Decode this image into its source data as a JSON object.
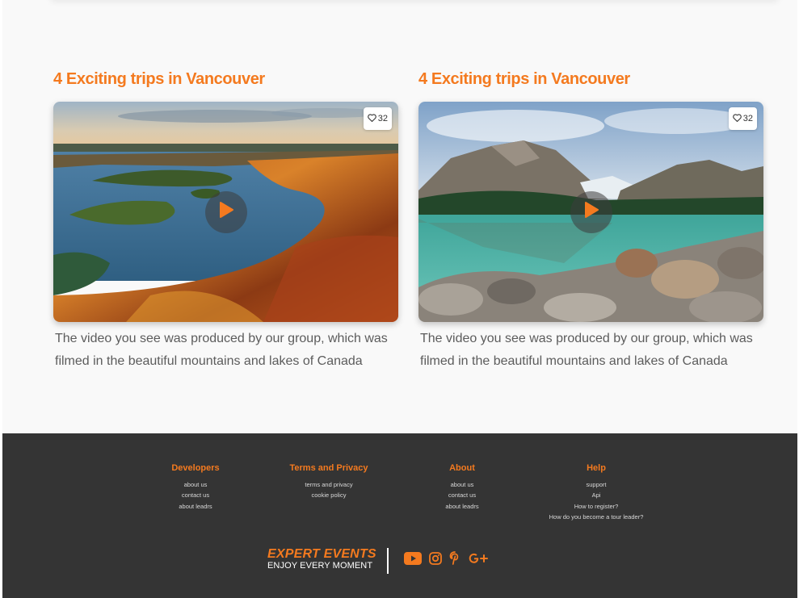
{
  "cards": [
    {
      "title": "4 Exciting trips in Vancouver",
      "likes": "32",
      "description": "The video you see was produced by our group, which was filmed in the beautiful mountains and lakes of Canada",
      "image": "autumn-lake-islands"
    },
    {
      "title": "4 Exciting trips in Vancouver",
      "likes": "32",
      "description": "The video you see was produced by our group, which was filmed in the beautiful mountains and lakes of Canada",
      "image": "mountain-lake-rocks"
    }
  ],
  "footer": {
    "columns": [
      {
        "heading": "Developers",
        "links": [
          "about us",
          "contact us",
          "about leadrs"
        ]
      },
      {
        "heading": "Terms and Privacy",
        "links": [
          "terms and privacy",
          "cookie policy"
        ]
      },
      {
        "heading": "About",
        "links": [
          "about us",
          "contact us",
          "about leadrs"
        ]
      },
      {
        "heading": "Help",
        "links": [
          "support",
          "Api",
          "How to register?",
          "How do you become a tour leader?"
        ]
      }
    ],
    "brand": {
      "title": "EXPERT EVENTS",
      "tagline": "ENJOY EVERY MOMENT"
    },
    "socials": [
      "youtube-icon",
      "instagram-icon",
      "pinterest-icon",
      "google-plus-icon"
    ]
  },
  "colors": {
    "accent": "#f47a1f",
    "footer_bg": "#343434",
    "page_bg": "#f9f9f9",
    "body_text": "#5c5c5c"
  }
}
